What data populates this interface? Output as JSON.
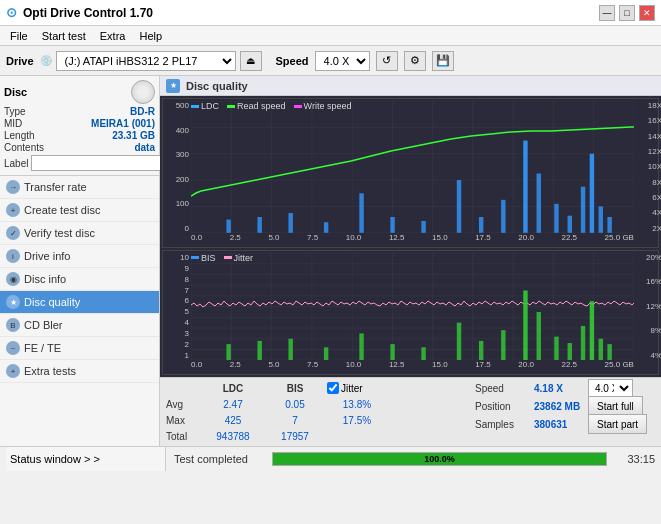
{
  "app": {
    "title": "Opti Drive Control 1.70",
    "icon": "⊙"
  },
  "winButtons": {
    "minimize": "—",
    "maximize": "□",
    "close": "✕"
  },
  "menu": {
    "items": [
      "File",
      "Start test",
      "Extra",
      "Help"
    ]
  },
  "toolbar": {
    "driveLabel": "Drive",
    "driveValue": "(J:)  ATAPI iHBS312  2 PL17",
    "speedLabel": "Speed",
    "speedValue": "4.0 X"
  },
  "disc": {
    "title": "Disc",
    "typeLabel": "Type",
    "typeValue": "BD-R",
    "midLabel": "MID",
    "midValue": "MEIRA1 (001)",
    "lengthLabel": "Length",
    "lengthValue": "23.31 GB",
    "contentsLabel": "Contents",
    "contentsValue": "data",
    "labelLabel": "Label",
    "labelValue": ""
  },
  "nav": {
    "items": [
      {
        "id": "transfer-rate",
        "label": "Transfer rate",
        "active": false
      },
      {
        "id": "create-test-disc",
        "label": "Create test disc",
        "active": false
      },
      {
        "id": "verify-test-disc",
        "label": "Verify test disc",
        "active": false
      },
      {
        "id": "drive-info",
        "label": "Drive info",
        "active": false
      },
      {
        "id": "disc-info",
        "label": "Disc info",
        "active": false
      },
      {
        "id": "disc-quality",
        "label": "Disc quality",
        "active": true
      },
      {
        "id": "cd-bler",
        "label": "CD Bler",
        "active": false
      },
      {
        "id": "fe-te",
        "label": "FE / TE",
        "active": false
      },
      {
        "id": "extra-tests",
        "label": "Extra tests",
        "active": false
      }
    ]
  },
  "discQuality": {
    "title": "Disc quality",
    "legend": {
      "ldc": "LDC",
      "readSpeed": "Read speed",
      "writeSpeed": "Write speed",
      "bis": "BIS",
      "jitter": "Jitter"
    },
    "topChart": {
      "yLabels": [
        "500",
        "400",
        "300",
        "200",
        "100",
        "0"
      ],
      "yLabelsRight": [
        "18X",
        "16X",
        "14X",
        "12X",
        "10X",
        "8X",
        "6X",
        "4X",
        "2X"
      ],
      "xLabels": [
        "0.0",
        "2.5",
        "5.0",
        "7.5",
        "10.0",
        "12.5",
        "15.0",
        "17.5",
        "20.0",
        "22.5",
        "25.0 GB"
      ]
    },
    "bottomChart": {
      "yLabels": [
        "10",
        "9",
        "8",
        "7",
        "6",
        "5",
        "4",
        "3",
        "2",
        "1"
      ],
      "yLabelsRight": [
        "20%",
        "16%",
        "12%",
        "8%",
        "4%"
      ],
      "xLabels": [
        "0.0",
        "2.5",
        "5.0",
        "7.5",
        "10.0",
        "12.5",
        "15.0",
        "17.5",
        "20.0",
        "22.5",
        "25.0 GB"
      ]
    }
  },
  "stats": {
    "columns": {
      "headers": [
        "",
        "LDC",
        "BIS",
        "",
        "Jitter",
        "Speed",
        ""
      ],
      "avg": {
        "label": "Avg",
        "ldc": "2.47",
        "bis": "0.05",
        "jitter": "13.8%"
      },
      "max": {
        "label": "Max",
        "ldc": "425",
        "bis": "7",
        "jitter": "17.5%"
      },
      "total": {
        "label": "Total",
        "ldc": "943788",
        "bis": "17957",
        "jitter": ""
      }
    },
    "jitterChecked": true,
    "speed": {
      "label": "Speed",
      "value": "4.18 X",
      "dropdownValue": "4.0 X"
    },
    "position": {
      "label": "Position",
      "value": "23862 MB"
    },
    "samples": {
      "label": "Samples",
      "value": "380631"
    },
    "startFull": "Start full",
    "startPart": "Start part"
  },
  "statusBar": {
    "label": "Status window > >",
    "statusText": "Test completed",
    "progress": "100.0%",
    "progressValue": 100,
    "time": "33:15"
  }
}
